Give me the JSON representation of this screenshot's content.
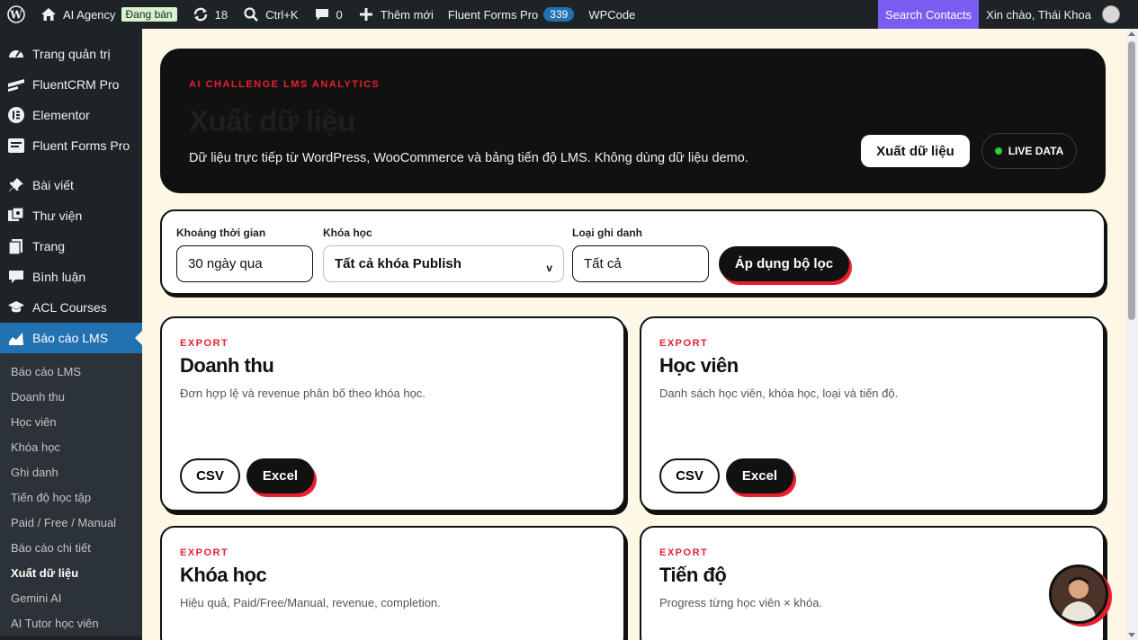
{
  "adminbar": {
    "site_name": "AI Agency",
    "status_badge": "Đang bán",
    "updates_count": "18",
    "search_shortcut": "Ctrl+K",
    "comments_count": "0",
    "add_new": "Thêm mới",
    "fluent_forms": "Fluent Forms Pro",
    "fluent_forms_count": "339",
    "wpcode": "WPCode",
    "search_contacts": "Search Contacts",
    "greeting": "Xin chào, Thái Khoa"
  },
  "sidebar": {
    "items": [
      {
        "label": "Trang quản trị",
        "icon": "dashboard-icon"
      },
      {
        "label": "FluentCRM Pro",
        "icon": "fluentcrm-icon"
      },
      {
        "label": "Elementor",
        "icon": "elementor-icon"
      },
      {
        "label": "Fluent Forms Pro",
        "icon": "fluentforms-icon"
      },
      {
        "label": "Bài viết",
        "icon": "pin-icon"
      },
      {
        "label": "Thư viện",
        "icon": "media-icon"
      },
      {
        "label": "Trang",
        "icon": "page-icon"
      },
      {
        "label": "Bình luận",
        "icon": "comment-icon"
      },
      {
        "label": "ACL Courses",
        "icon": "graduation-cap-icon"
      },
      {
        "label": "Báo cáo LMS",
        "icon": "chart-area-icon"
      }
    ],
    "submenu": [
      "Báo cáo LMS",
      "Doanh thu",
      "Học viên",
      "Khóa học",
      "Ghi danh",
      "Tiến độ học tập",
      "Paid / Free / Manual",
      "Báo cáo chi tiết",
      "Xuất dữ liệu",
      "Gemini AI",
      "AI Tutor học viên"
    ]
  },
  "hero": {
    "kicker": "AI CHALLENGE LMS ANALYTICS",
    "title": "Xuất dữ liệu",
    "description": "Dữ liệu trực tiếp từ WordPress, WooCommerce và bảng tiến độ LMS. Không dùng dữ liệu demo.",
    "export_button": "Xuất dữ liệu",
    "live_label": "LIVE DATA"
  },
  "filters": {
    "time_label": "Khoảng thời gian",
    "time_value": "30 ngày qua",
    "course_label": "Khóa học",
    "course_value": "Tất cả khóa Publish",
    "course_caret": "v",
    "enroll_label": "Loại ghi danh",
    "enroll_value": "Tất cả",
    "apply_button": "Áp dụng bộ lọc"
  },
  "cards": [
    {
      "kicker": "EXPORT",
      "title": "Doanh thu",
      "desc": "Đơn hợp lệ và revenue phân bố theo khóa học.",
      "csv": "CSV",
      "excel": "Excel"
    },
    {
      "kicker": "EXPORT",
      "title": "Học viên",
      "desc": "Danh sách học viên, khóa học, loại và tiến độ.",
      "csv": "CSV",
      "excel": "Excel"
    },
    {
      "kicker": "EXPORT",
      "title": "Khóa học",
      "desc": "Hiệu quả, Paid/Free/Manual, revenue, completion."
    },
    {
      "kicker": "EXPORT",
      "title": "Tiến độ",
      "desc": "Progress từng học viên × khóa."
    }
  ],
  "colors": {
    "accent_red": "#e8202d",
    "admin_dark": "#1d2327",
    "admin_blue": "#2271b1",
    "page_bg": "#fdf8e6",
    "search_purple": "#7b5cf0"
  }
}
